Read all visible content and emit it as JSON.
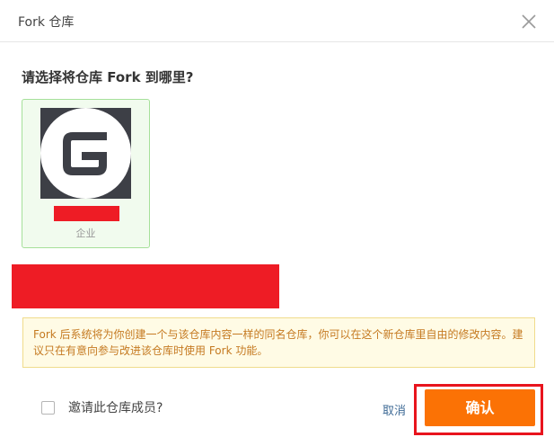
{
  "dialog": {
    "title": "Fork 仓库"
  },
  "question": "请选择将仓库 Fork 到哪里?",
  "org_card": {
    "type_label": "企业"
  },
  "notice": "Fork 后系统将为你创建一个与该仓库内容一样的同名仓库，你可以在这个新仓库里自由的修改内容。建议只在有意向参与改进该仓库时使用 Fork 功能。",
  "invite": {
    "label": "邀请此仓库成员?",
    "checked": false
  },
  "actions": {
    "cancel_label": "取消",
    "confirm_label": "确认"
  },
  "colors": {
    "confirm_bg": "#fb7205",
    "highlight_outline": "#e8141d",
    "redaction": "#ee1c25",
    "card_border": "#a6e09a",
    "notice_text": "#c57a21",
    "notice_bg": "#fffbe5"
  },
  "icons": {
    "close": "close-icon",
    "org_logo": "gitee-logo-icon"
  }
}
